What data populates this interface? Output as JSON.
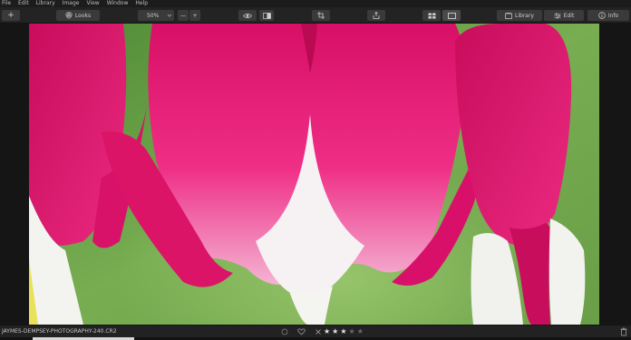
{
  "menu": [
    "File",
    "Edit",
    "Library",
    "Image",
    "View",
    "Window",
    "Help"
  ],
  "toolbar": {
    "add_label": "+",
    "looks_label": "Looks",
    "zoom_value": "50%",
    "zoom_out": "—",
    "zoom_in": "+",
    "library_label": "Library",
    "edit_label": "Edit",
    "info_label": "Info"
  },
  "status": {
    "filename": "JAYMES-DEMPSEY-PHOTOGRAPHY-240.CR2",
    "rating_stars_filled": 3,
    "rating_stars_total": 5
  },
  "colors": {
    "accent": "#e0e0e0",
    "petal": "#e0136e",
    "background_green": "#6aa24a"
  }
}
